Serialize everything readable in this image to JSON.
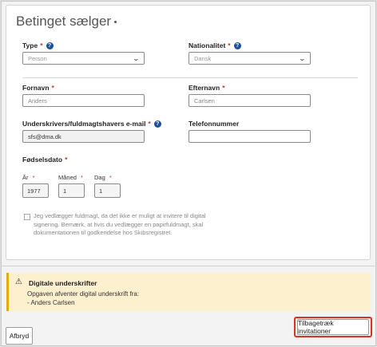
{
  "card": {
    "title": "Betinget sælger"
  },
  "fields": {
    "type": {
      "label": "Type",
      "value": "Person"
    },
    "nationality": {
      "label": "Nationalitet",
      "value": "Dansk"
    },
    "first_name": {
      "label": "Fornavn",
      "value": "Anders"
    },
    "last_name": {
      "label": "Efternavn",
      "value": "Carlsen"
    },
    "email": {
      "label": "Underskrivers/fuldmagtshavers e-mail",
      "value": "sfs@dma.dk"
    },
    "phone": {
      "label": "Telefonnummer",
      "value": ""
    },
    "birthdate": {
      "label": "Fødselsdato",
      "year_label": "År",
      "year": "1977",
      "month_label": "Måned",
      "month": "1",
      "day_label": "Dag",
      "day": "1"
    }
  },
  "required_marker": "*",
  "checkbox": {
    "text": "Jeg vedlægger fuldmagt, da det ikke er muligt at invitere til digital signering. Bemærk, at hvis du vedlægger en papirfuldmagt, skal dokumentationen til godkendelse hos Skibsregistret."
  },
  "warning": {
    "title": "Digitale underskrifter",
    "line1": "Opgaven afventer digital underskrift fra:",
    "line2": "- Anders Carlsen"
  },
  "buttons": {
    "cancel": "Afbryd",
    "withdraw": "Tilbagetræk invitationer"
  },
  "colors": {
    "accent": "#1c4f9c",
    "required": "#c0392b",
    "warning_bg": "#fdf0cf",
    "highlight": "#d9302a"
  },
  "icons": {
    "help": "question-circle",
    "warning": "warning-triangle",
    "select": "chevron-down"
  }
}
